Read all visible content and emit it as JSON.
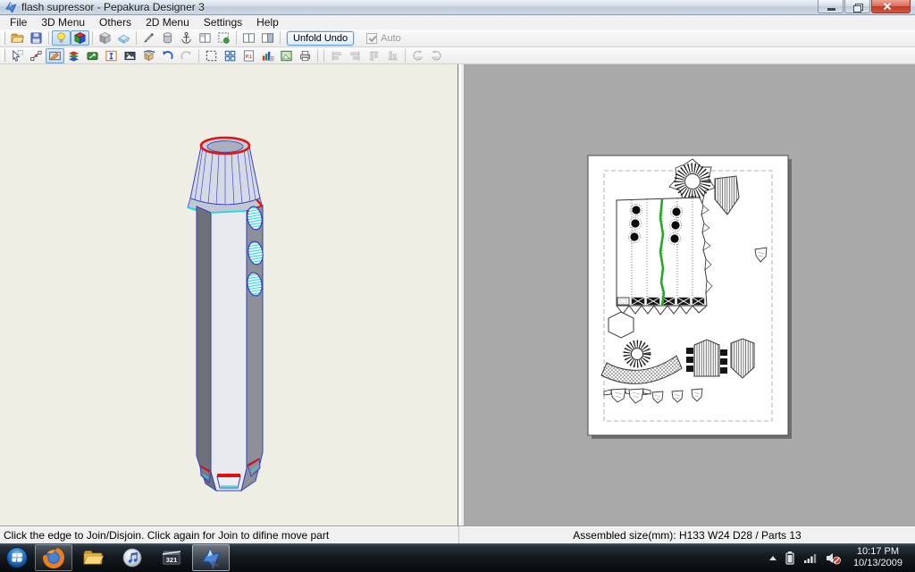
{
  "window": {
    "title": "flash supressor - Pepakura Designer 3"
  },
  "menubar": {
    "items": [
      "File",
      "3D Menu",
      "Others",
      "2D Menu",
      "Settings",
      "Help"
    ]
  },
  "toolbar_top": {
    "icons": [
      "open-folder",
      "save",
      "light-toggle",
      "textured-view",
      "solid-view",
      "flat-view",
      "pen-tool",
      "cylinder-tool",
      "anchor-tool",
      "divided-window",
      "select-parts",
      "two-pane-layout",
      "right-pane-layout"
    ],
    "unfold_undo_label": "Unfold Undo",
    "auto_label": "Auto"
  },
  "toolbar_edit": {
    "icons": [
      "select-object",
      "select-edge",
      "edit-pattern",
      "material-colors",
      "measure-tool",
      "insert-text",
      "insert-image",
      "rotate-box",
      "undo",
      "redo",
      "zoom-selection",
      "arrange-parts",
      "page-number",
      "export-image",
      "print-preview",
      "print",
      "align-left",
      "align-right",
      "align-top",
      "align-bottom",
      "rotate-left-90",
      "rotate-right-90"
    ],
    "page_icon_label": "P.1",
    "rotate_left_label": "90",
    "rotate_right_label": "90"
  },
  "statusbar": {
    "message": "Click the edge to Join/Disjoin. Click again for Join to difine move part",
    "assembled": "Assembled size(mm): H133 W24 D28 / Parts 13"
  },
  "taskbar": {
    "apps": [
      "start-orb",
      "firefox",
      "windows-explorer",
      "itunes",
      "media-player-classic",
      "pepakura-designer"
    ],
    "mpc_label": "321",
    "tray_icons": [
      "hidden-icons-chevron",
      "battery",
      "network-signal",
      "volume-muted"
    ],
    "clock": {
      "time": "10:17 PM",
      "date": "10/13/2009"
    }
  },
  "colors": {
    "left_pane_bg": "#eeeee4",
    "right_pane_bg": "#a9a9a9",
    "page_bg": "#ffffff",
    "selected_edge_green": "#1fae1f",
    "open_edge_red": "#dd1616",
    "cut_edge_cyan": "#20d5ea",
    "fold_edge_blue": "#3040c0"
  }
}
